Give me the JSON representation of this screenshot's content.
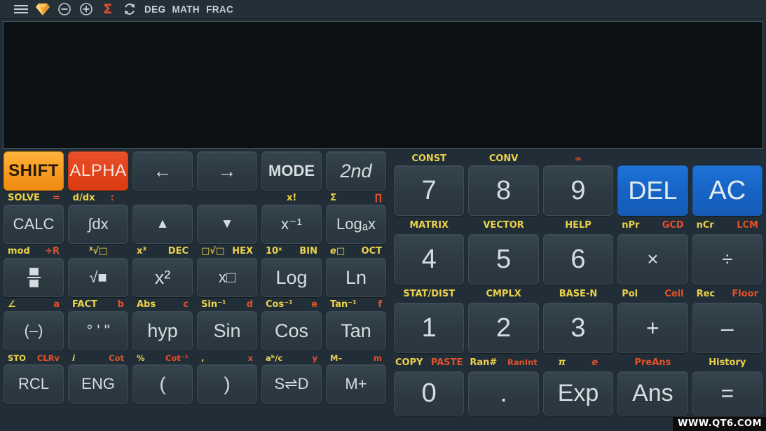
{
  "header": {
    "icons": [
      "menu-icon",
      "diamond-icon",
      "zoom-out-icon",
      "zoom-in-icon",
      "sigma-icon",
      "refresh-icon"
    ],
    "status": [
      "DEG",
      "MATH",
      "FRAC"
    ],
    "accent_orange": "#f79a2c",
    "accent_red": "#e2512b"
  },
  "display": {
    "value": ""
  },
  "left_pad": {
    "row1_keys": [
      {
        "label": "SHIFT",
        "style": "shift"
      },
      {
        "label": "ALPHA",
        "style": "alpha"
      },
      {
        "label": "←",
        "style": "plain"
      },
      {
        "label": "→",
        "style": "plain"
      },
      {
        "label": "MODE",
        "style": "bold"
      },
      {
        "label": "2nd",
        "style": "italic"
      }
    ],
    "row1_labels": [
      {
        "yellow": "SOLVE",
        "red": "="
      },
      {
        "yellow": "d/dx",
        "red": ":"
      },
      {
        "yellow": "",
        "red": ""
      },
      {
        "yellow": "",
        "red": ""
      },
      {
        "yellow": "x!",
        "red": ""
      },
      {
        "yellow": "Σ",
        "red": "∏"
      }
    ],
    "row2_keys": [
      {
        "label": "CALC"
      },
      {
        "label": "∫dx"
      },
      {
        "label": "▲"
      },
      {
        "label": "▼"
      },
      {
        "label": "x⁻¹"
      },
      {
        "label": "Logₐx"
      }
    ],
    "row2_labels": [
      {
        "yellow": "mod",
        "red": "÷R"
      },
      {
        "yellow": "³√□",
        "red": ""
      },
      {
        "yellow": "x³",
        "red": "DEC"
      },
      {
        "yellow": "□√□",
        "red": "HEX"
      },
      {
        "yellow": "10ˣ",
        "red": "BIN"
      },
      {
        "yellow": "e□",
        "red": "OCT"
      }
    ],
    "row3_keys": [
      {
        "label": "fraction-icon"
      },
      {
        "label": "√■"
      },
      {
        "label": "x²"
      },
      {
        "label": "x□"
      },
      {
        "label": "Log"
      },
      {
        "label": "Ln"
      }
    ],
    "row3_labels": [
      {
        "yellow": "∠",
        "red": "a"
      },
      {
        "yellow": "FACT",
        "red": "b"
      },
      {
        "yellow": "Abs",
        "red": "c"
      },
      {
        "yellow": "Sin⁻¹",
        "red": "d"
      },
      {
        "yellow": "Cos⁻¹",
        "red": "e"
      },
      {
        "yellow": "Tan⁻¹",
        "red": "f"
      }
    ],
    "row4_keys": [
      {
        "label": "(–)"
      },
      {
        "label": "° ' \""
      },
      {
        "label": "hyp"
      },
      {
        "label": "Sin"
      },
      {
        "label": "Cos"
      },
      {
        "label": "Tan"
      }
    ],
    "row4_labels": [
      {
        "yellow": "STO",
        "red": "CLRv"
      },
      {
        "yellow": "i",
        "red": "Cot"
      },
      {
        "yellow": "%",
        "red": "Cot⁻¹"
      },
      {
        "yellow": ",",
        "red": "x"
      },
      {
        "yellow": "aᵇ/ᴄ",
        "red": "y"
      },
      {
        "yellow": "M–",
        "red": "m"
      }
    ],
    "row5_keys": [
      {
        "label": "RCL"
      },
      {
        "label": "ENG"
      },
      {
        "label": "("
      },
      {
        "label": ")"
      },
      {
        "label": "S⇌D"
      },
      {
        "label": "M+"
      }
    ]
  },
  "right_pad": {
    "row0_labels": [
      {
        "yellow": "CONST",
        "red": ""
      },
      {
        "yellow": "CONV",
        "red": ""
      },
      {
        "yellow": "",
        "red": "∞"
      },
      {
        "yellow": "",
        "red": ""
      },
      {
        "yellow": "",
        "red": ""
      }
    ],
    "row1_keys": [
      {
        "label": "7"
      },
      {
        "label": "8"
      },
      {
        "label": "9"
      },
      {
        "label": "DEL",
        "style": "blue"
      },
      {
        "label": "AC",
        "style": "blue"
      }
    ],
    "row1_labels": [
      {
        "yellow": "MATRIX",
        "red": ""
      },
      {
        "yellow": "VECTOR",
        "red": ""
      },
      {
        "yellow": "HELP",
        "red": ""
      },
      {
        "yellow": "nPr",
        "red": "GCD"
      },
      {
        "yellow": "nCr",
        "red": "LCM"
      }
    ],
    "row2_keys": [
      {
        "label": "4"
      },
      {
        "label": "5"
      },
      {
        "label": "6"
      },
      {
        "label": "×"
      },
      {
        "label": "÷"
      }
    ],
    "row2_labels": [
      {
        "yellow": "STAT/DIST",
        "red": ""
      },
      {
        "yellow": "CMPLX",
        "red": ""
      },
      {
        "yellow": "BASE-N",
        "red": ""
      },
      {
        "yellow": "Pol",
        "red": "Ceil"
      },
      {
        "yellow": "Rec",
        "red": "Floor"
      }
    ],
    "row3_keys": [
      {
        "label": "1"
      },
      {
        "label": "2"
      },
      {
        "label": "3"
      },
      {
        "label": "+"
      },
      {
        "label": "–"
      }
    ],
    "row3_labels": [
      {
        "yellow": "COPY",
        "red": "PASTE"
      },
      {
        "yellow": "Ran#",
        "red": "RanInt"
      },
      {
        "yellow": "π",
        "red": "e"
      },
      {
        "yellow": "",
        "red": "PreAns"
      },
      {
        "yellow": "History",
        "red": ""
      }
    ],
    "row4_keys": [
      {
        "label": "0"
      },
      {
        "label": "."
      },
      {
        "label": "Exp"
      },
      {
        "label": "Ans"
      },
      {
        "label": "="
      }
    ]
  },
  "watermark": {
    "text": "WWW.QT6.COM"
  }
}
